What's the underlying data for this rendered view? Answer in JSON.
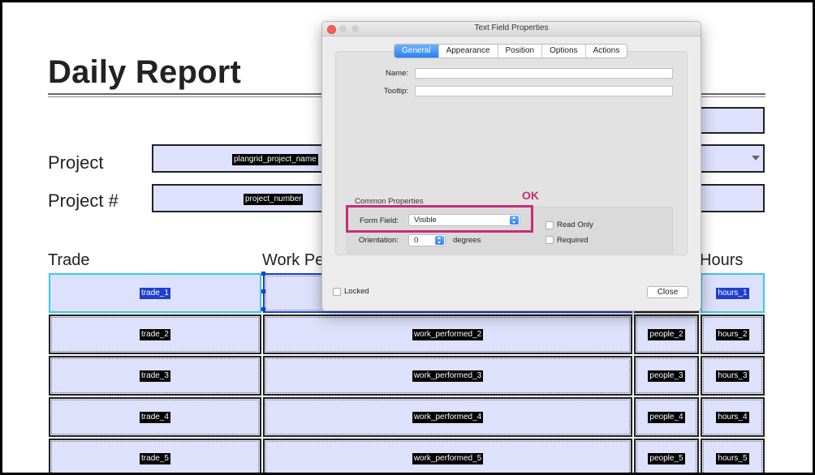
{
  "document": {
    "title": "Daily Report",
    "labels": {
      "project": "Project",
      "project_number": "Project #",
      "trade": "Trade",
      "work_performed_partial": "Work Pe",
      "hours": "Hours"
    },
    "fields": {
      "project_name": "plangrid_project_name",
      "project_number": "project_number"
    },
    "rows": [
      {
        "trade": "trade_1",
        "work": "",
        "people": "",
        "hours": "hours_1"
      },
      {
        "trade": "trade_2",
        "work": "work_performed_2",
        "people": "people_2",
        "hours": "hours_2"
      },
      {
        "trade": "trade_3",
        "work": "work_performed_3",
        "people": "people_3",
        "hours": "hours_3"
      },
      {
        "trade": "trade_4",
        "work": "work_performed_4",
        "people": "people_4",
        "hours": "hours_4"
      },
      {
        "trade": "trade_5",
        "work": "work_performed_5",
        "people": "people_5",
        "hours": "hours_5"
      }
    ]
  },
  "dialog": {
    "title": "Text Field Properties",
    "tabs": [
      "General",
      "Appearance",
      "Position",
      "Options",
      "Actions"
    ],
    "active_tab": "General",
    "name_label": "Name:",
    "name_value": "",
    "tooltip_label": "Tooltip:",
    "tooltip_value": "",
    "common_properties_label": "Common Properties",
    "form_field_label": "Form Field:",
    "form_field_value": "Visible",
    "orientation_label": "Orientation:",
    "orientation_value": "0",
    "degrees_label": "degrees",
    "read_only_label": "Read Only",
    "required_label": "Required",
    "locked_label": "Locked",
    "close_label": "Close"
  },
  "annotation": {
    "text": "OK",
    "color": "#c62d7a"
  },
  "colors": {
    "field_fill": "#dde1fb",
    "selection_blue": "#1d3fcf",
    "focus_cyan": "#3ac8e8",
    "tab_active": "#2b7ff3"
  }
}
